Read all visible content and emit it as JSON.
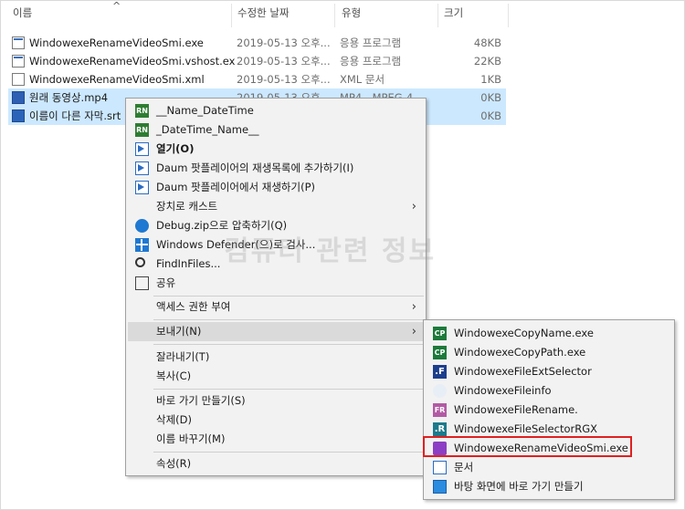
{
  "header": {
    "col_name": "이름",
    "col_date": "수정한 날짜",
    "col_type": "유형",
    "col_size": "크기",
    "sort_arrow": "^"
  },
  "files": [
    {
      "name": "WindowexeRenameVideoSmi.exe",
      "date": "2019-05-13 오후...",
      "type": "응용 프로그램",
      "size": "48KB",
      "icon": "exe-icon",
      "selected": false
    },
    {
      "name": "WindowexeRenameVideoSmi.vshost.exe",
      "date": "2019-05-13 오후...",
      "type": "응용 프로그램",
      "size": "22KB",
      "icon": "exe-icon",
      "selected": false
    },
    {
      "name": "WindowexeRenameVideoSmi.xml",
      "date": "2019-05-13 오후...",
      "type": "XML 문서",
      "size": "1KB",
      "icon": "xml-icon",
      "selected": false
    },
    {
      "name": "원래 동영상.mp4",
      "date": "2019-05-13 오후...",
      "type": "MP4 - MPEG-4",
      "size": "0KB",
      "icon": "video-icon",
      "selected": true
    },
    {
      "name": "이름이 다른 자막.srt",
      "date": "",
      "type": "",
      "size": "0KB",
      "icon": "subtitle-icon",
      "selected": true
    }
  ],
  "watermark": "컴퓨터 관련 정보",
  "context_menu": {
    "items": [
      {
        "label": "__Name_DateTime",
        "icon": "rn-icon"
      },
      {
        "label": "_DateTime_Name__",
        "icon": "rn-icon"
      },
      {
        "label": "열기(O)",
        "icon": "play-icon",
        "bold": true
      },
      {
        "label": "Daum 팟플레이어의 재생목록에 추가하기(I)",
        "icon": "play-icon"
      },
      {
        "label": "Daum 팟플레이어에서 재생하기(P)",
        "icon": "play-icon"
      },
      {
        "label": "장치로 캐스트",
        "icon": "",
        "submenu": true
      },
      {
        "label": "Debug.zip으로 압축하기(Q)",
        "icon": "compress-icon"
      },
      {
        "label": "Windows Defender(으)로 검사...",
        "icon": "defender-icon"
      },
      {
        "label": "FindInFiles...",
        "icon": "search-icon"
      },
      {
        "label": "공유",
        "icon": "share-icon"
      },
      {
        "label": "액세스 권한 부여",
        "icon": "",
        "submenu": true
      },
      {
        "label": "보내기(N)",
        "icon": "",
        "submenu": true,
        "highlighted": true
      },
      {
        "label": "잘라내기(T)",
        "icon": ""
      },
      {
        "label": "복사(C)",
        "icon": ""
      },
      {
        "label": "바로 가기 만들기(S)",
        "icon": ""
      },
      {
        "label": "삭제(D)",
        "icon": ""
      },
      {
        "label": "이름 바꾸기(M)",
        "icon": ""
      },
      {
        "label": "속성(R)",
        "icon": ""
      }
    ],
    "arrow": "›"
  },
  "sendto_menu": {
    "items": [
      {
        "label": "WindowexeCopyName.exe",
        "icon": "cp-icon",
        "badge": "CP"
      },
      {
        "label": "WindowexeCopyPath.exe",
        "icon": "cp-icon",
        "badge": "CP"
      },
      {
        "label": "WindowexeFileExtSelector",
        "icon": "fileext-icon",
        "badge": ".F"
      },
      {
        "label": "WindowexeFileinfo",
        "icon": "info-icon",
        "badge": ""
      },
      {
        "label": "WindowexeFileRename.",
        "icon": "fr-icon",
        "badge": "FR"
      },
      {
        "label": "WindowexeFileSelectorRGX",
        "icon": "rgx-icon",
        "badge": ".R"
      },
      {
        "label": "WindowexeRenameVideoSmi.exe",
        "icon": "rename-video-icon",
        "badge": "",
        "highlighted_box": true
      },
      {
        "label": "문서",
        "icon": "document-icon",
        "badge": ""
      },
      {
        "label": "바탕 화면에 바로 가기 만들기",
        "icon": "desktop-icon",
        "badge": ""
      }
    ]
  },
  "colors": {
    "selection": "#cce8ff",
    "menu_bg": "#f2f2f2",
    "menu_highlight": "#dadada",
    "red_box": "#e02020"
  }
}
